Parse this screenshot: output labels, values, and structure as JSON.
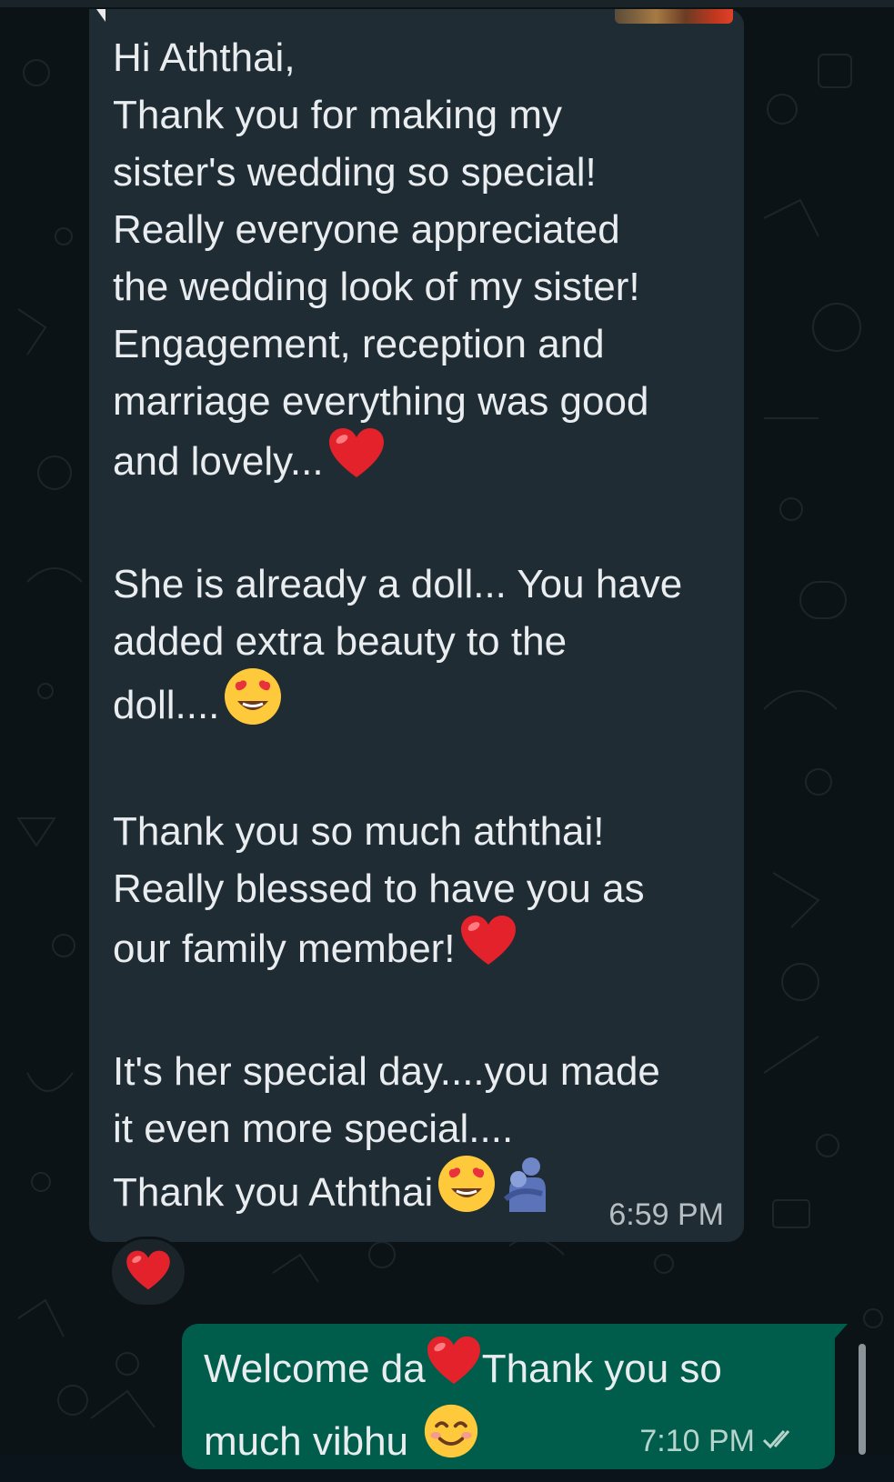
{
  "incoming_message": {
    "lines": [
      "Hi Aththai,",
      "Thank you for making my",
      "sister's wedding so special!",
      "Really everyone appreciated",
      "the wedding look of my sister!",
      "Engagement, reception and",
      "marriage everything was good",
      "and lovely...",
      "",
      "She is already a doll... You have",
      "added extra beauty to the",
      "doll....",
      "",
      "Thank you so much aththai!",
      "Really blessed to have you as",
      "our family member!",
      "",
      "It's her special day....you made",
      "it even more special....",
      "Thank you Aththai"
    ],
    "time": "6:59 PM",
    "reaction": "red-heart-icon"
  },
  "outgoing_message": {
    "line1_a": "Welcome da",
    "line1_b": "Thank you so",
    "line2": "much  vibhu",
    "time": "7:10 PM",
    "status": "double-check-icon"
  },
  "colors": {
    "incoming_bubble": "#202c33",
    "outgoing_bubble": "#005c4b",
    "background": "#0c1317",
    "text": "#e9edef"
  }
}
